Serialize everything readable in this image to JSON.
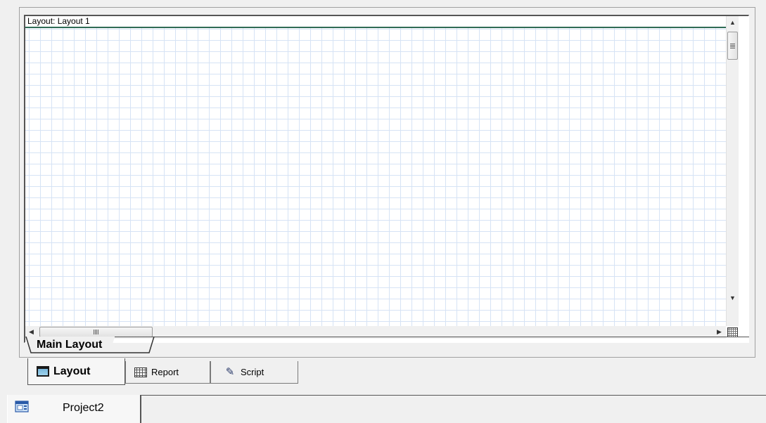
{
  "canvas": {
    "header_label": "Layout: Layout 1"
  },
  "scrollbars": {
    "vertical": {
      "up_icon": "arrow-up-icon",
      "down_icon": "arrow-down-icon"
    },
    "horizontal": {
      "left_icon": "arrow-left-icon",
      "right_icon": "arrow-right-icon"
    },
    "corner_icon": "grid-toggle-icon"
  },
  "sheet_tabs": [
    {
      "label": "Main Layout",
      "active": true
    }
  ],
  "view_tabs": [
    {
      "label": "Layout",
      "icon": "layout-icon",
      "active": true
    },
    {
      "label": "Report",
      "icon": "report-grid-icon",
      "active": false
    },
    {
      "label": "Script",
      "icon": "script-icon",
      "active": false
    }
  ],
  "project_tabs": [
    {
      "label": "Project2",
      "icon": "project-icon",
      "active": true
    }
  ],
  "colors": {
    "header_underline": "#2e6b55",
    "grid_line": "#d6e3f5",
    "background": "#f0f0f0"
  }
}
